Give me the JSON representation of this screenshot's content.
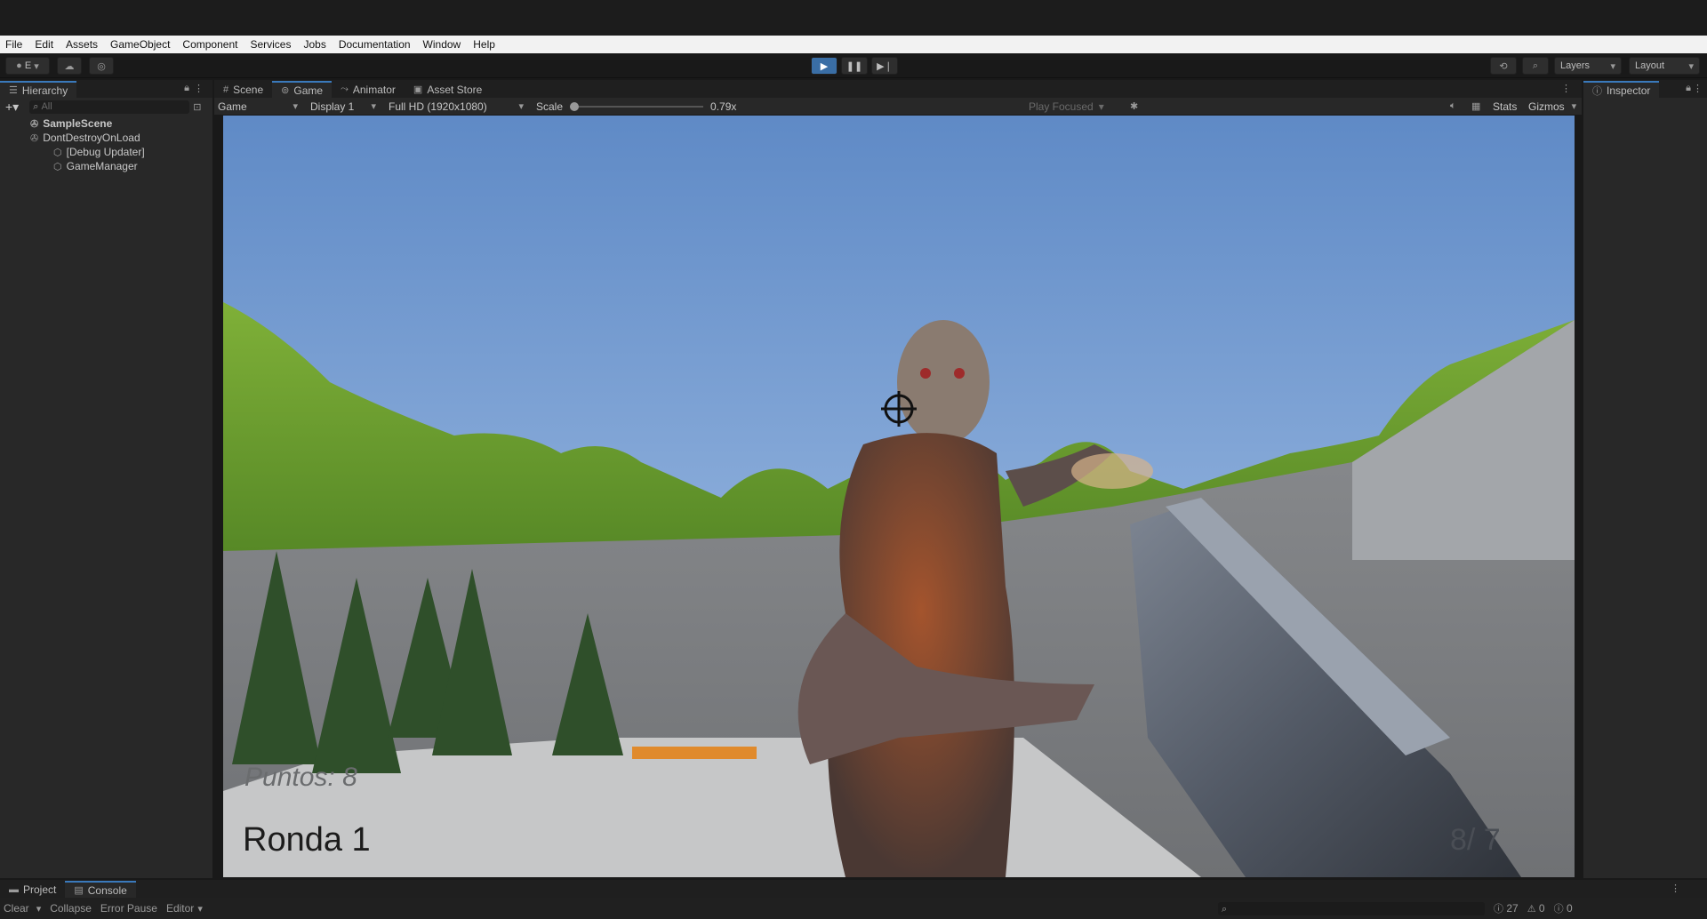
{
  "menu": [
    "File",
    "Edit",
    "Assets",
    "GameObject",
    "Component",
    "Services",
    "Jobs",
    "Documentation",
    "Window",
    "Help"
  ],
  "toolbar": {
    "account": "E",
    "layers": "Layers",
    "layout": "Layout"
  },
  "hierarchy": {
    "tab": "Hierarchy",
    "search_placeholder": "All",
    "items": [
      {
        "label": "SampleScene",
        "bold": true
      },
      {
        "label": "DontDestroyOnLoad",
        "bold": false
      },
      {
        "label": "[Debug Updater]",
        "bold": false
      },
      {
        "label": "GameManager",
        "bold": false
      }
    ]
  },
  "center_tabs": [
    "Scene",
    "Game",
    "Animator",
    "Asset Store"
  ],
  "gamebar": {
    "view": "Game",
    "display": "Display 1",
    "resolution": "Full HD (1920x1080)",
    "scale_label": "Scale",
    "scale_value": "0.79x",
    "play_focused": "Play Focused",
    "stats": "Stats",
    "gizmos": "Gizmos"
  },
  "inspector": {
    "tab": "Inspector"
  },
  "game": {
    "puntos": "Puntos: 8",
    "ronda": "Ronda 1",
    "ammo": "8/ 7"
  },
  "bottom": {
    "tabs": [
      "Project",
      "Console"
    ],
    "clear": "Clear",
    "collapse": "Collapse",
    "error_pause": "Error Pause",
    "editor": "Editor",
    "log_count": "27",
    "warn_count": "0",
    "error_count": "0"
  },
  "colors": {
    "accent": "#3a79bb",
    "sky": "#6b92c8"
  }
}
